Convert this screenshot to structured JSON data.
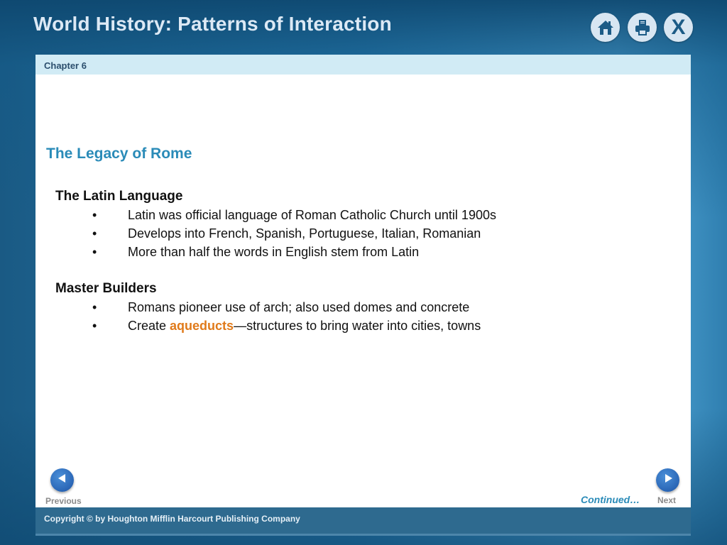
{
  "header": {
    "app_title": "World History: Patterns of Interaction",
    "buttons": [
      {
        "name": "home",
        "icon": "home-icon"
      },
      {
        "name": "print",
        "icon": "printer-icon"
      },
      {
        "name": "close",
        "icon": "close-icon",
        "label": "X"
      }
    ]
  },
  "chapter": {
    "label": "Chapter 6"
  },
  "slide": {
    "title": "The Legacy of Rome",
    "sections": [
      {
        "heading": "The Latin Language",
        "bullets": [
          "Latin was official language of Roman Catholic Church until 1900s",
          "Develops into French, Spanish, Portuguese, Italian, Romanian",
          "More than half the words in English stem from Latin"
        ]
      },
      {
        "heading": "Master Builders",
        "bullets": [
          "Romans pioneer use of arch; also used domes and concrete"
        ],
        "bullet_with_highlight": {
          "prefix": "Create ",
          "highlight": "aqueducts",
          "suffix": "—structures to bring water into cities, towns"
        }
      }
    ],
    "bullet_char": "•",
    "highlight_color": "#e07a1a"
  },
  "navigation": {
    "previous_label": "Previous",
    "next_label": "Next",
    "continued_label": "Continued…"
  },
  "footer": {
    "copyright": "Copyright © by Houghton Mifflin Harcourt Publishing Company"
  }
}
